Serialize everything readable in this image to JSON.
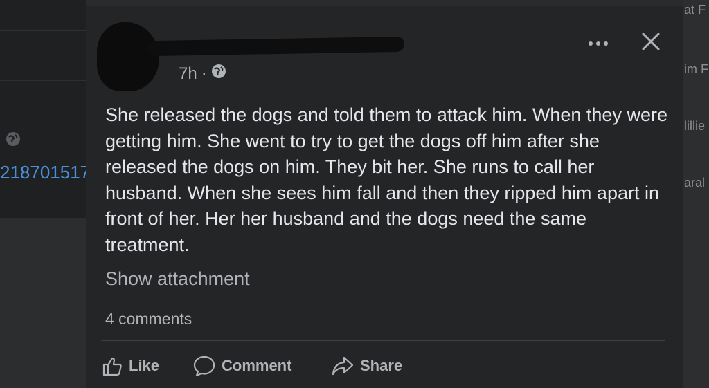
{
  "background": {
    "left_id_text": "218701517",
    "right_texts": [
      "at F",
      "im F",
      "lillie",
      "aral"
    ]
  },
  "post": {
    "timestamp": "7h",
    "separator": "·",
    "audience_icon": "globe-icon",
    "body": "She released the dogs and told them to attack him. When they were getting him. She went to try to get the dogs off him after she released the dogs on him. They bit her. She runs to call her husband. When she sees him fall and then they ripped him apart in front of her. Her her husband and the dogs need the same treatment.",
    "show_attachment": "Show attachment",
    "comments_count": "4 comments"
  },
  "header_actions": {
    "more_icon": "more-options-icon",
    "close_icon": "close-icon"
  },
  "actions": {
    "like": "Like",
    "comment": "Comment",
    "share": "Share"
  },
  "colors": {
    "card_bg": "#242526",
    "text_primary": "#e4e6eb",
    "text_secondary": "#b0b3b8",
    "link_blue": "#4a90d9"
  }
}
